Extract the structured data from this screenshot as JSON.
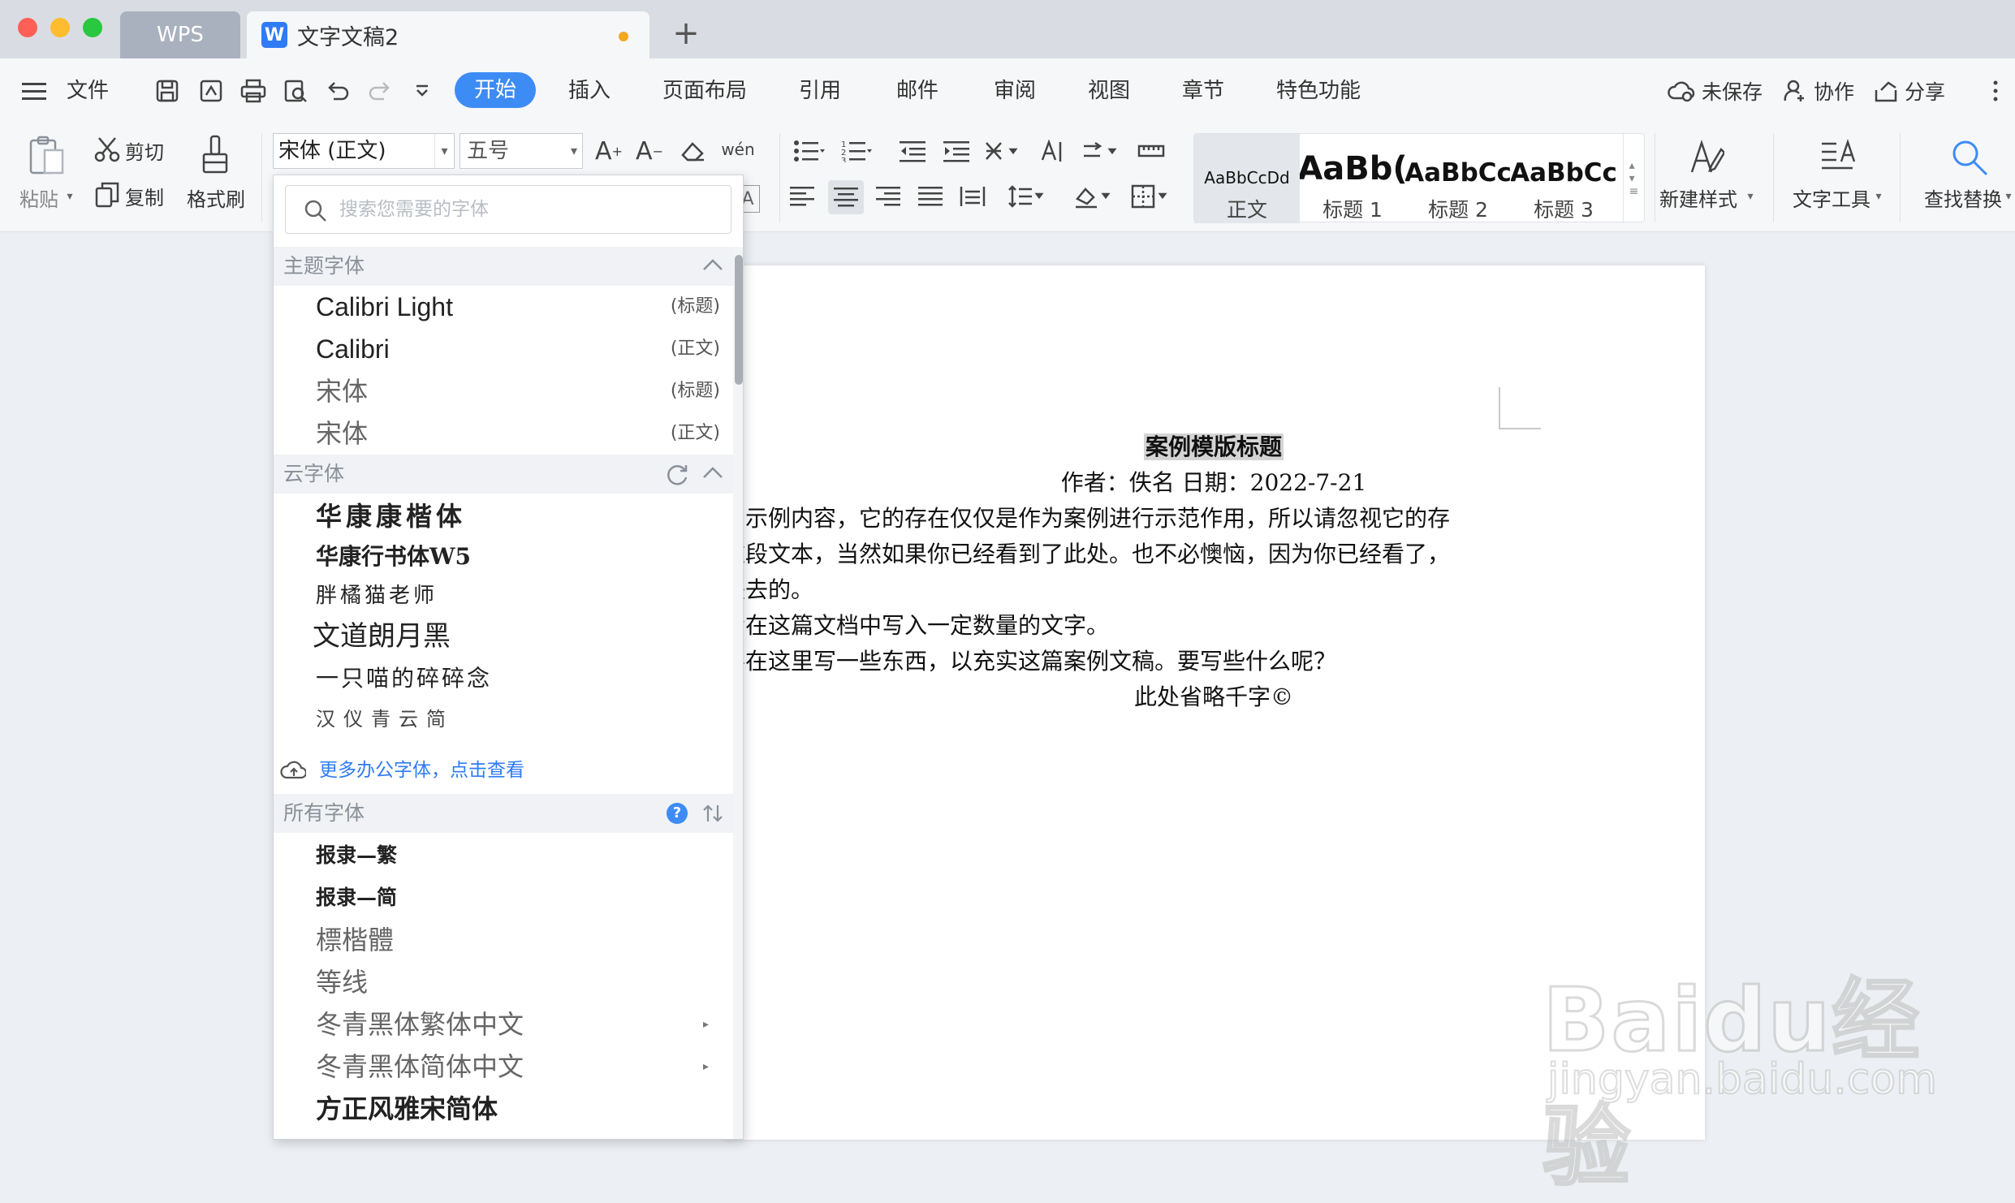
{
  "titlebar": {
    "tabs": [
      {
        "label": "WPS"
      },
      {
        "label": "文字文稿2",
        "unsaved_dot": true
      }
    ],
    "add_tab": "+"
  },
  "menu": {
    "file_label": "文件",
    "items": [
      "开始",
      "插入",
      "页面布局",
      "引用",
      "邮件",
      "审阅",
      "视图",
      "章节",
      "特色功能"
    ],
    "active": "开始",
    "right": {
      "unsaved": "未保存",
      "collab": "协作",
      "share": "分享"
    }
  },
  "ribbon": {
    "paste": "粘贴",
    "cut": "剪切",
    "copy": "复制",
    "format_painter": "格式刷",
    "font_name": "宋体 (正文)",
    "font_size": "五号",
    "styles": [
      {
        "preview": "AaBbCcDd",
        "name": "正文"
      },
      {
        "preview": "AaBb(",
        "name": "标题 1"
      },
      {
        "preview": "AaBbCc",
        "name": "标题 2"
      },
      {
        "preview": "AaBbCc",
        "name": "标题 3"
      }
    ],
    "new_style": "新建样式",
    "text_tools": "文字工具",
    "find_replace": "查找替换"
  },
  "font_dropdown": {
    "search_placeholder": "搜索您需要的字体",
    "theme_section": "主题字体",
    "theme_fonts": [
      {
        "name": "Calibri Light",
        "tag": "(标题)"
      },
      {
        "name": "Calibri",
        "tag": "(正文)"
      },
      {
        "name": "宋体",
        "tag": "(标题)"
      },
      {
        "name": "宋体",
        "tag": "(正文)"
      }
    ],
    "cloud_section": "云字体",
    "cloud_fonts": [
      "华康康楷体",
      "华康行书体W5",
      "胖橘猫老师",
      "文道朗月黑",
      "一只喵的碎碎念",
      "汉仪青云简"
    ],
    "more_link": "更多办公字体，点击查看",
    "all_section": "所有字体",
    "all_fonts": [
      {
        "name": "报隶—繁",
        "submenu": false
      },
      {
        "name": "报隶—简",
        "submenu": false
      },
      {
        "name": "標楷體",
        "submenu": false
      },
      {
        "name": "等线",
        "submenu": false
      },
      {
        "name": "冬青黑体繁体中文",
        "submenu": true
      },
      {
        "name": "冬青黑体简体中文",
        "submenu": true
      },
      {
        "name": "方正风雅宋简体",
        "submenu": false
      }
    ]
  },
  "document": {
    "title": "案例模版标题",
    "meta": "作者：佚名 日期：2022-7-21",
    "paragraphs": [
      "的示例内容，它的存在仅仅是作为案例进行示范作用，所以请忽视它的存",
      "这段文本，当然如果你已经看到了此处。也不必懊恼，因为你已经看了，",
      "失去的。",
      "会在这篇文档中写入一定数量的文字。",
      "要在这里写一些东西，以充实这篇案例文稿。要写些什么呢？"
    ],
    "closing": "此处省略千字©"
  },
  "watermark": {
    "logo": "Baidu经验",
    "url": "jingyan.baidu.com"
  },
  "colors": {
    "accent": "#3d8cf5",
    "unsaved_dot": "#f5a623",
    "close": "#fe5f57",
    "minimize": "#febc2e",
    "maximize": "#28c840"
  }
}
